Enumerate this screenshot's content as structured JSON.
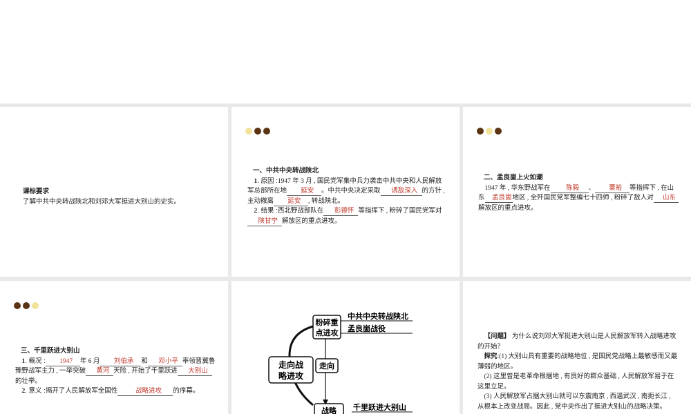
{
  "slide1": {
    "heading": "课标要求",
    "body": "了解中共中央转战陕北和刘邓大军挺进大别山的史实。"
  },
  "slide2": {
    "section_title": "一、中共中央转战陕北",
    "item1": {
      "num": "1",
      "label": ". 原因 :",
      "t1": "1947 年 3 月 , 国民党军集中兵力袭击中共中央和人民解放军总部所在地",
      "a1": "延安",
      "t2": "。中共中央决定采取",
      "a2": "诱敌深入",
      "t3": "的方针 , 主动撤离",
      "a3": "延安",
      "t4": ", 转战陕北。"
    },
    "item2": {
      "num": "2",
      "label": ". 结果 :",
      "t1": "西北野战部队在",
      "a1": "彭德怀",
      "t2": "等指挥下 , 粉碎了国民党军对",
      "a2": "陕甘宁",
      "t3": "解放区的重点进攻。"
    }
  },
  "slide3": {
    "section_title": "二、孟良崮上火如潮",
    "t1": "1947 年 , 华东野战军在",
    "a1": "陈毅",
    "t2": "、",
    "a2": "粟裕",
    "t3": "等指挥下 , 在山东",
    "a3": "孟良崮",
    "t4": "地区 , 全歼国民党军整编七十四师 , 粉碎了敌人对",
    "a4": "山东",
    "t5": "解放区的重点进攻。"
  },
  "slide4": {
    "section_title": "三、千里跃进大别山",
    "item1": {
      "num": "1",
      "label": ". 概况 :",
      "a1": "1947",
      "t1": "年 6 月",
      "a2": "刘伯承",
      "t2": "和",
      "a3": "邓小平",
      "t3": "率领晋冀鲁豫野战军主力 , 一举突破",
      "a4": "黄河",
      "t4": "天险 , 开始了千里跃进",
      "a5": "大别山",
      "t5": "的壮举。"
    },
    "item2": {
      "num": "2",
      "label": ". 意义 :",
      "t1": "揭开了人民解放军全国性",
      "a1": "战略进攻",
      "t2": "的序幕。"
    }
  },
  "slide5": {
    "center": [
      "走向战",
      "略进攻"
    ],
    "box_top": [
      "粉碎重",
      "点进攻"
    ],
    "box_mid": "走向",
    "box_bottom": "战略",
    "label1": "中共中央转战陕北",
    "label2": "孟良崮战役",
    "label3": "千里跃进大别山"
  },
  "slide6": {
    "q_label": "【问题】",
    "q_text": "为什么说刘邓大军挺进大别山是人民解放军转入战略进攻的开始？",
    "e_label": "探究",
    "e1": ":(1) 大别山具有重要的战略地位 , 是国民党战略上最敏感而又最薄弱的地区。",
    "e2": "(2) 这里曾是老革命根据地 , 有良好的群众基础 , 人民解放军易于在这里立足。",
    "e3": "(3) 人民解放军占据大别山就可以东震南京 , 西逼武汉 , 南扼长江 , 从根本上改变战局。因此 , 党中央作出了挺进大别山的战略决策。"
  },
  "colors": {
    "dot_dark": "#5b3413",
    "dot_light": "#f2e39a",
    "answer": "#c0392b"
  }
}
